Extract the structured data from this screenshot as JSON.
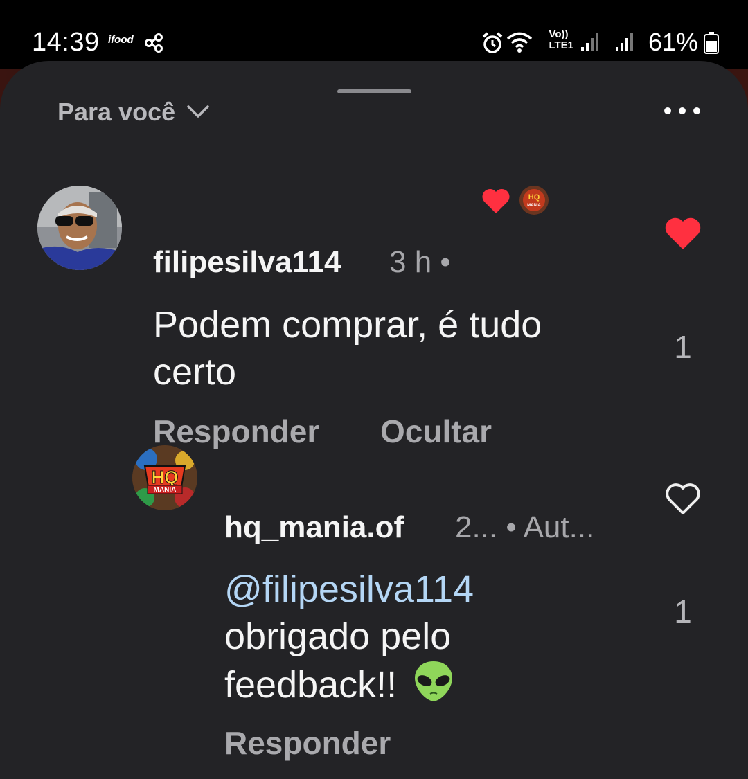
{
  "status_bar": {
    "time": "14:39",
    "ifood_label": "ifood",
    "volte_line1": "Vo))",
    "volte_line2": "LTE1",
    "battery": "61%"
  },
  "sheet": {
    "filter_label": "Para você",
    "icons": [
      "chevron-down-icon",
      "more-icon",
      "heart-icon",
      "heart-outline-icon",
      "threads-icon",
      "alien-emoji"
    ]
  },
  "comments": [
    {
      "username": "filipesilva114",
      "meta": "3 h •",
      "text_line1": "Podem comprar, é tudo",
      "text_line2": "certo",
      "reply_label": "Responder",
      "hide_label": "Ocultar",
      "likes": "1",
      "liked": true,
      "heart_color": "#ff3040"
    },
    {
      "username": "hq_mania.of",
      "meta": "2... • Aut...",
      "mention": "filipesilva114",
      "text_line2": "obrigado pelo",
      "text_line3": "feedback!!",
      "reply_label": "Responder",
      "likes": "1",
      "liked": false,
      "avatar_text": "HQ",
      "avatar_subtext": "MANIA"
    }
  ]
}
